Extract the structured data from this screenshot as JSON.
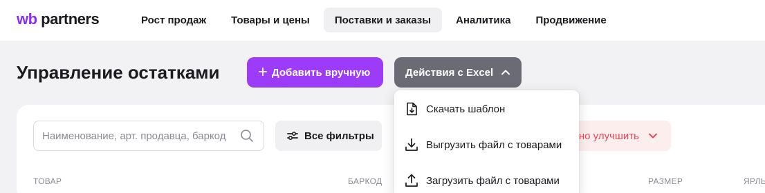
{
  "logo": {
    "prefix": "wb",
    "suffix": " partners"
  },
  "nav": [
    {
      "label": "Рост продаж",
      "active": false
    },
    {
      "label": "Товары и цены",
      "active": false
    },
    {
      "label": "Поставки и заказы",
      "active": true
    },
    {
      "label": "Аналитика",
      "active": false
    },
    {
      "label": "Продвижение",
      "active": false
    }
  ],
  "page": {
    "title": "Управление остатками",
    "add_button": "Добавить вручную",
    "excel_button": "Действия с Excel"
  },
  "filters": {
    "search_placeholder": "Наименование, арт. продавца, баркод",
    "all_filters": "Все фильтры",
    "improve_partial": "но улучшить"
  },
  "table": {
    "columns": [
      "ТОВАР",
      "БАРКОД",
      "РАЗМЕР",
      "ЯРЛЫ"
    ]
  },
  "excel_menu": {
    "items": [
      {
        "label": "Скачать шаблон",
        "icon": "file-download-icon"
      },
      {
        "label": "Выгрузить файл с товарами",
        "icon": "download-icon"
      },
      {
        "label": "Загрузить файл с товарами",
        "icon": "upload-icon"
      }
    ]
  },
  "colors": {
    "brand": "#9c3cf8",
    "excel_button": "#6b6b75",
    "warning_text": "#e8475b",
    "warning_bg": "#fdeeee"
  }
}
